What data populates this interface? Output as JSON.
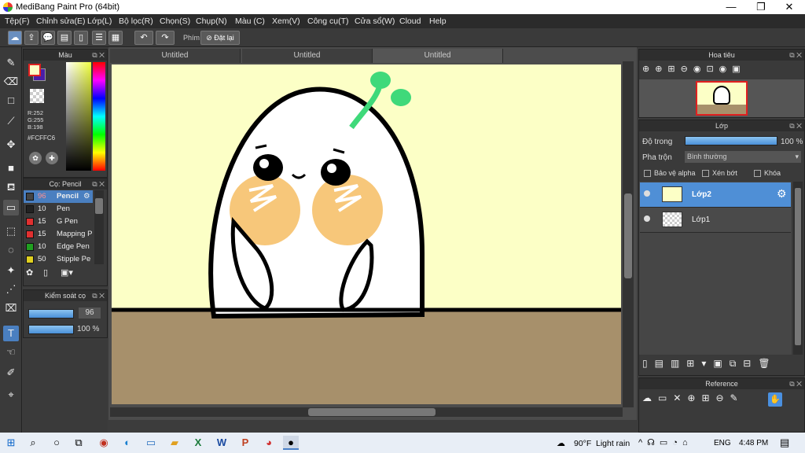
{
  "app": {
    "title": "MediBang Paint Pro (64bit)"
  },
  "menu": [
    "Tệp(F)",
    "Chỉnh sửa(E)",
    "Lớp(L)",
    "Bộ lọc(R)",
    "Chọn(S)",
    "Chụp(N)",
    "Màu (C)",
    "Xem(V)",
    "Công cụ(T)",
    "Cửa sổ(W)",
    "Cloud",
    "Help"
  ],
  "toolbar": {
    "shortcut_label": "Phím",
    "reset_label": "Đặt lại"
  },
  "color_panel": {
    "title": "Màu",
    "r": "R:252",
    "g": "G:255",
    "b": "B:198",
    "hex": "#FCFFC6"
  },
  "brush_panel": {
    "title": "Cọ: Pencil",
    "items": [
      {
        "size": "96",
        "name": "Pencil",
        "color": "#444444",
        "active": true
      },
      {
        "size": "10",
        "name": "Pen",
        "color": "#222222"
      },
      {
        "size": "15",
        "name": "G Pen",
        "color": "#e03030"
      },
      {
        "size": "15",
        "name": "Mapping P",
        "color": "#e03030"
      },
      {
        "size": "10",
        "name": "Edge Pen",
        "color": "#20a020"
      },
      {
        "size": "50",
        "name": "Stipple Pe",
        "color": "#e0d020"
      }
    ]
  },
  "brush_control": {
    "title": "Kiểm soát cọ",
    "size": "96",
    "opacity": "100 %"
  },
  "tabs": [
    "Untitled",
    "Untitled",
    "Untitled"
  ],
  "navigator": {
    "title": "Hoa tiêu"
  },
  "layer_panel": {
    "title": "Lớp",
    "opacity_label": "Độ trong",
    "opacity_value": "100 %",
    "blend_label": "Pha trộn",
    "blend_value": "Bình thường",
    "protect_alpha": "Bảo vệ alpha",
    "clipping": "Xén bớt",
    "lock": "Khóa",
    "layers": [
      {
        "name": "Lớp2",
        "active": true
      },
      {
        "name": "Lớp1",
        "active": false
      }
    ]
  },
  "reference": {
    "title": "Reference"
  },
  "taskbar": {
    "weather_temp": "90°F",
    "weather_desc": "Light rain",
    "language": "ENG",
    "time": "4:48 PM"
  },
  "colors": {
    "canvas_bg": "#fcffc6",
    "floor": "#a7906b",
    "accent_blue": "#5aa0e0"
  }
}
